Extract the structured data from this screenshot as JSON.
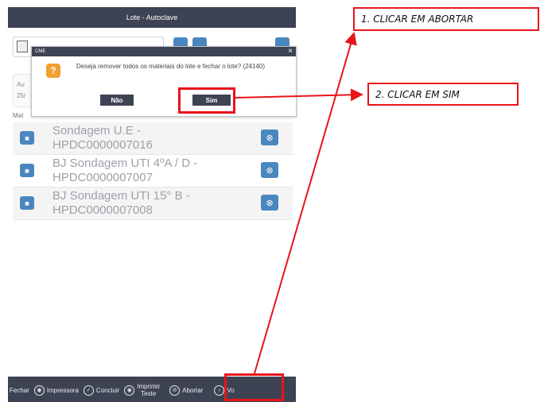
{
  "window": {
    "title": "Lote - Autoclave"
  },
  "info": {
    "line1": "Au",
    "line2": "25/"
  },
  "section": {
    "label": "Mat"
  },
  "materials": [
    {
      "line1": "Sondagem U.E -",
      "line2": "HPDC0000007016"
    },
    {
      "line1": "BJ Sondagem UTI 4ºA / D -",
      "line2": "HPDC0000007007"
    },
    {
      "line1": "BJ Sondagem UTI 15° B -",
      "line2": "HPDC0000007008"
    }
  ],
  "dialog": {
    "title": "CME",
    "close": "×",
    "message": "Deseja remover todos os materiais do lote e fechar o lote? (24140)",
    "no_label": "Não",
    "yes_label": "Sim"
  },
  "bottom_bar": {
    "fechar": "Fechar",
    "impressora": "Impressora",
    "concluir": "Concluir",
    "imprimir_1": "Imprimir",
    "imprimir_2": "Teste",
    "abortar": "Abortar",
    "voltar": "Vo"
  },
  "annotations": {
    "step1": "1. CLICAR EM ABORTAR",
    "step2": "2. CLICAR EM SIM"
  },
  "colors": {
    "annotation": "#e8141a",
    "header": "#3d4352",
    "accent": "#4a87c0"
  }
}
